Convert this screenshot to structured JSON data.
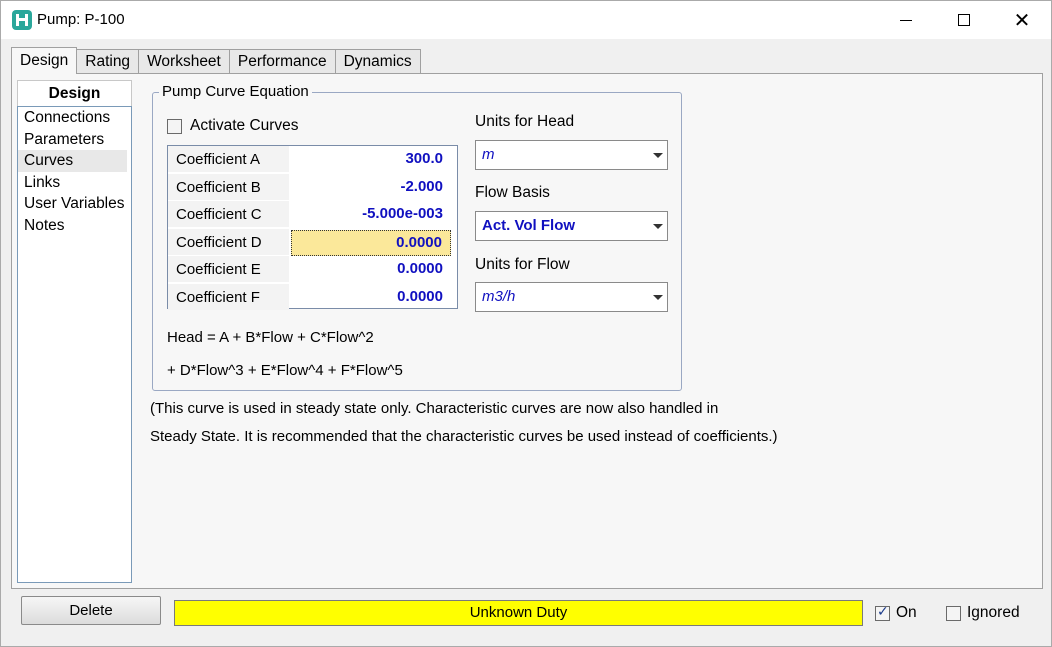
{
  "window": {
    "title": "Pump: P-100"
  },
  "tabs": [
    {
      "label": "Design"
    },
    {
      "label": "Rating"
    },
    {
      "label": "Worksheet"
    },
    {
      "label": "Performance"
    },
    {
      "label": "Dynamics"
    }
  ],
  "nav": {
    "header": "Design",
    "items": [
      {
        "label": "Connections"
      },
      {
        "label": "Parameters"
      },
      {
        "label": "Curves"
      },
      {
        "label": "Links"
      },
      {
        "label": "User Variables"
      },
      {
        "label": "Notes"
      }
    ],
    "selected": "Curves"
  },
  "curve_group": {
    "title": "Pump Curve Equation",
    "activate_label": "Activate Curves",
    "activate_checked": false,
    "coefficients": [
      {
        "label": "Coefficient A",
        "value": "300.0"
      },
      {
        "label": "Coefficient B",
        "value": "-2.000"
      },
      {
        "label": "Coefficient C",
        "value": "-5.000e-003"
      },
      {
        "label": "Coefficient D",
        "value": "0.0000"
      },
      {
        "label": "Coefficient E",
        "value": "0.0000"
      },
      {
        "label": "Coefficient F",
        "value": "0.0000"
      }
    ],
    "equation_line1": "Head = A + B*Flow + C*Flow^2",
    "equation_line2": "+ D*Flow^3 + E*Flow^4 + F*Flow^5",
    "units_head_label": "Units for Head",
    "units_head_value": "m",
    "flow_basis_label": "Flow Basis",
    "flow_basis_value": "Act. Vol Flow",
    "units_flow_label": "Units for Flow",
    "units_flow_value": "m3/h"
  },
  "notes": {
    "line1": "(This curve is used in steady state only.  Characteristic curves are now also handled in",
    "line2": "Steady State.  It is recommended that the characteristic curves be used instead of coefficients.)"
  },
  "bottom": {
    "delete_label": "Delete",
    "status_text": "Unknown Duty",
    "status_color": "#ffff00",
    "on_label": "On",
    "on_checked": true,
    "ignored_label": "Ignored",
    "ignored_checked": false
  }
}
